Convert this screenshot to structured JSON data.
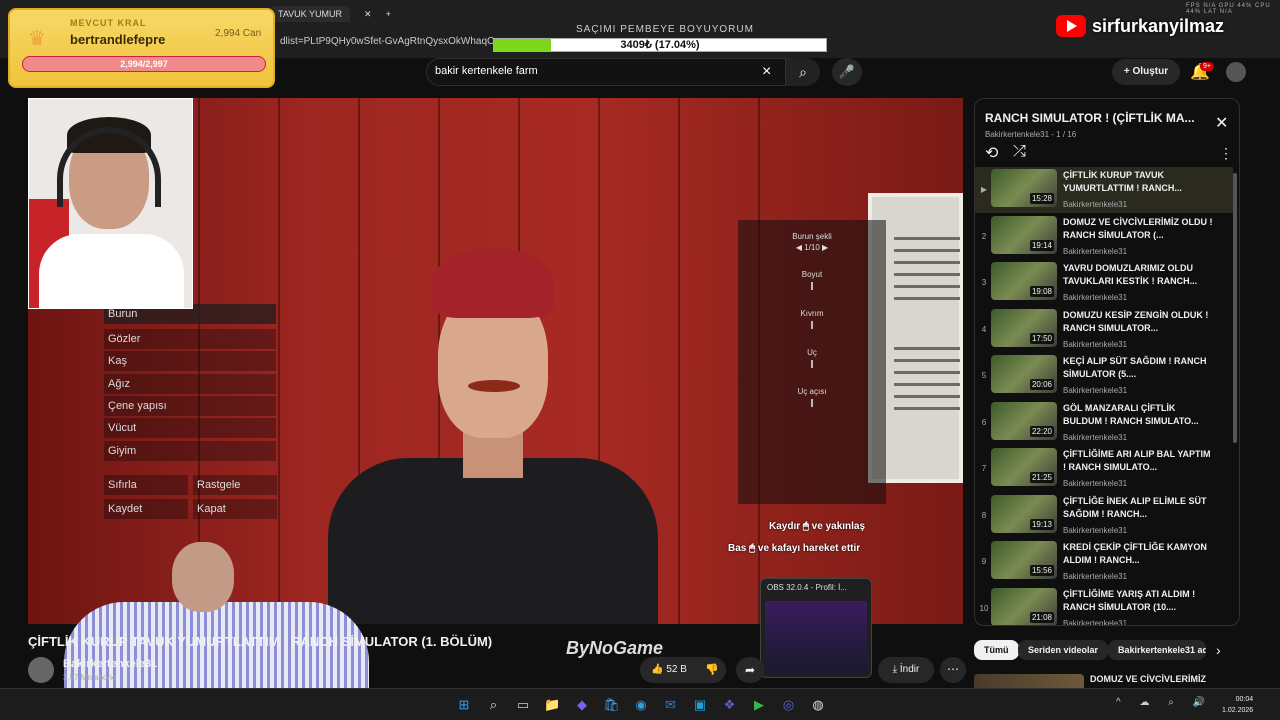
{
  "browser": {
    "tab_label": "TAVUK YUMUR",
    "url_fragment": "dlist=PLtP9QHy0wSfet-GvAgRtnQysxOkWhaqCs",
    "perf_readout": "FPS N/A  GPU 44%  CPU 44%  LAT N/A"
  },
  "goal": {
    "title": "SAÇIMI PEMBEYE BOYUYORUM",
    "progress_text": "3409₺ (17.04%)",
    "progress_fraction": 0.1704,
    "fill_color": "#7cd61a"
  },
  "king": {
    "label": "MEVCUT KRAL",
    "name": "bertrandlefepre",
    "amount": "2,994 Can",
    "health_text": "2,994/2,997",
    "crown_icon": "crown-icon"
  },
  "watermark": {
    "text": "sirfurkanyilmaz"
  },
  "search": {
    "value": "bakir kertenkele farm",
    "clear_icon": "×",
    "search_icon": "⌕",
    "mic_icon": "🎤"
  },
  "header": {
    "create_label": "Oluştur",
    "create_icon": "+",
    "bell_icon": "🔔",
    "notif_count": "9+"
  },
  "game": {
    "menu": [
      "Burun",
      "Gözler",
      "Kaş",
      "Ağız",
      "Çene yapısı",
      "Vücut",
      "Giyim"
    ],
    "buttons": {
      "reset": "Sıfırla",
      "random": "Rastgele",
      "save": "Kaydet",
      "close": "Kapat"
    },
    "sliders": {
      "nose_shape_label": "Burun şekli",
      "nose_shape_value": "◀ 1/10 ▶",
      "height_label": "Boyut",
      "curve_label": "Kıvrım",
      "tip_label": "Uç",
      "tip_angle_label": "Uç açısı"
    },
    "hint_scroll": "Kaydır 🖱 ve yakınlaş",
    "hint_press": "Bas 🖱 ve kafayı hareket ettir"
  },
  "obs": {
    "title": "OBS 32.0.4 - Profil: İ..."
  },
  "video": {
    "title": "ÇİFTLİK KURUP TAVUK YUMURTLATTIM ! RANCH SİMULATOR (1. BÖLÜM)",
    "channel": "Bakirkertenkele31",
    "subs": "3,57 Mn abone",
    "brand": "ByNoGame",
    "likes": "52 B",
    "like_icon": "👍",
    "dislike_icon": "👎",
    "share_icon": "➦",
    "download_label": "İndir",
    "download_icon": "⤓",
    "more_icon": "⋯"
  },
  "playlist": {
    "title": "RANCH SIMULATOR ! (ÇİFTLİK MA...",
    "meta": "Bakirkertenkele31 - 1 / 16",
    "close_icon": "✕",
    "loop_icon": "⟲",
    "shuffle_icon": "⤮",
    "menu_icon": "⋮",
    "items": [
      {
        "idx": "▶",
        "dur": "15:28",
        "title": "ÇİFTLİK KURUP TAVUK YUMURTLATTIM ! RANCH...",
        "channel": "Bakirkertenkele31"
      },
      {
        "idx": "2",
        "dur": "19:14",
        "title": "DOMUZ VE CİVCİVLERİMİZ OLDU ! RANCH SİMULATOR (...",
        "channel": "Bakirkertenkele31"
      },
      {
        "idx": "3",
        "dur": "19:08",
        "title": "YAVRU DOMUZLARIMIZ OLDU TAVUKLARI KESTİK ! RANCH...",
        "channel": "Bakirkertenkele31"
      },
      {
        "idx": "4",
        "dur": "17:50",
        "title": "DOMUZU KESİP ZENGİN OLDUK ! RANCH SIMULATOR...",
        "channel": "Bakirkertenkele31"
      },
      {
        "idx": "5",
        "dur": "20:06",
        "title": "KEÇİ ALIP SÜT SAĞDIM ! RANCH SİMULATOR (5....",
        "channel": "Bakirkertenkele31"
      },
      {
        "idx": "6",
        "dur": "22:20",
        "title": "GÖL MANZARALI ÇİFTLİK BULDUM ! RANCH SIMULATO...",
        "channel": "Bakirkertenkele31"
      },
      {
        "idx": "7",
        "dur": "21:25",
        "title": "ÇİFTLİĞİME ARI ALIP BAL YAPTIM ! RANCH SIMULATO...",
        "channel": "Bakirkertenkele31"
      },
      {
        "idx": "8",
        "dur": "19:13",
        "title": "ÇİFTLİĞE İNEK ALIP ELİMLE SÜT SAĞDIM ! RANCH...",
        "channel": "Bakirkertenkele31"
      },
      {
        "idx": "9",
        "dur": "15:56",
        "title": "KREDİ ÇEKİP ÇİFTLİĞE KAMYON ALDIM ! RANCH...",
        "channel": "Bakirkertenkele31"
      },
      {
        "idx": "10",
        "dur": "21:08",
        "title": "ÇİFTLİĞİME YARIŞ ATI ALDIM ! RANCH SİMULATOR (10....",
        "channel": "Bakirkertenkele31"
      }
    ]
  },
  "chips": {
    "all": "Tümü",
    "series": "Seriden videolar",
    "channel": "Bakirkertenkele31 ad",
    "next_icon": "›"
  },
  "next_video": {
    "title": "DOMUZ VE CİVCİVLERİMİZ"
  },
  "taskbar": {
    "icons": [
      "⊞",
      "⌕",
      "▭",
      "📁",
      "◆",
      "🛍",
      "◉",
      "✉",
      "▣",
      "❖",
      "▶",
      "◎",
      "◍"
    ],
    "tray": "^ ☁ ⌕ 🔊",
    "time": "00:04",
    "date": "1.02.2026"
  }
}
